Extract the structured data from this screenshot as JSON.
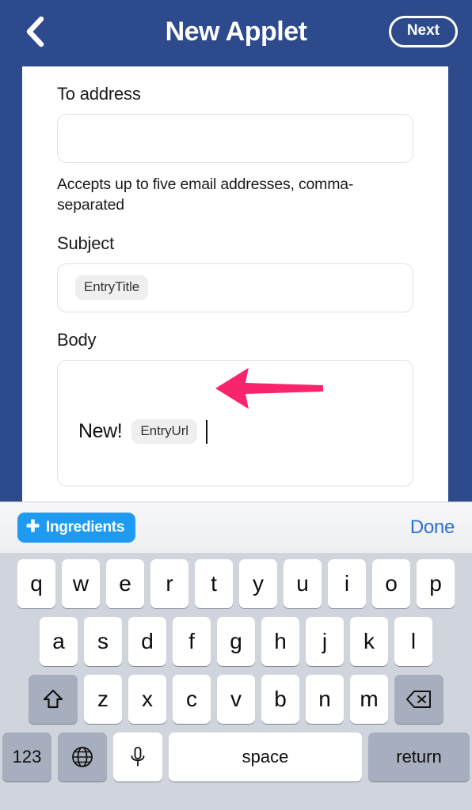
{
  "header": {
    "back_icon": "chevron-left-icon",
    "title": "New Applet",
    "next_label": "Next"
  },
  "form": {
    "to": {
      "label": "To address",
      "value": "",
      "placeholder": "",
      "helper": "Accepts up to five email addresses, comma-separated"
    },
    "subject": {
      "label": "Subject",
      "chip": "EntryTitle"
    },
    "body": {
      "label": "Body",
      "text": "New!",
      "chip": "EntryUrl"
    }
  },
  "annotations": {
    "arrow_color": "#f8246c",
    "arrow_body_target": "body-field",
    "arrow_ingredients_target": "ingredients-button"
  },
  "accessory_bar": {
    "ingredients_label": "Ingredients",
    "plus_icon": "plus-icon",
    "ingredients_color": "#1e9bf0",
    "done_label": "Done",
    "done_color": "#2d6fd0"
  },
  "keyboard": {
    "row1": [
      "q",
      "w",
      "e",
      "r",
      "t",
      "y",
      "u",
      "i",
      "o",
      "p"
    ],
    "row2": [
      "a",
      "s",
      "d",
      "f",
      "g",
      "h",
      "j",
      "k",
      "l"
    ],
    "row3": [
      "z",
      "x",
      "c",
      "v",
      "b",
      "n",
      "m"
    ],
    "shift_icon": "shift-arrow-icon",
    "backspace_icon": "backspace-icon",
    "numbers_label": "123",
    "globe_icon": "globe-icon",
    "mic_icon": "microphone-icon",
    "space_label": "space",
    "return_label": "return",
    "background_color": "#d0d4dc"
  },
  "theme": {
    "app_blue": "#2c4a8c",
    "card_background": "#ffffff",
    "chip_background": "#efefef"
  }
}
